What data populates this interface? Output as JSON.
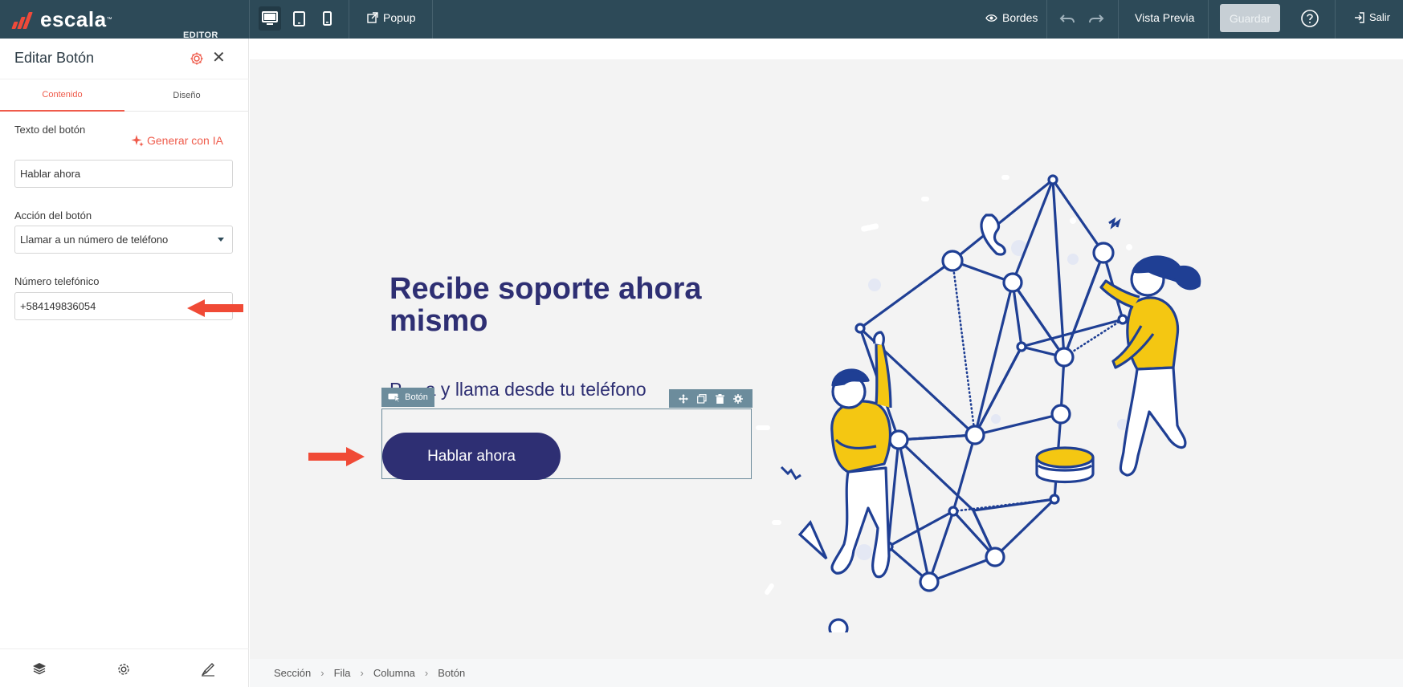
{
  "brand": {
    "name": "escala",
    "tm": "™",
    "editor_label": "EDITOR",
    "bars_color": "#ef4a3a"
  },
  "toolbar": {
    "popup_label": "Popup",
    "borders_label": "Bordes",
    "preview_label": "Vista Previa",
    "save_label": "Guardar",
    "exit_label": "Salir",
    "icons": [
      "desktop-icon",
      "tablet-icon",
      "mobile-icon",
      "external-link-icon",
      "eye-icon",
      "undo-icon",
      "redo-icon",
      "help-icon",
      "logout-icon"
    ]
  },
  "panel": {
    "title": "Editar Botón",
    "tabs": [
      {
        "label": "Contenido",
        "active": true
      },
      {
        "label": "Diseño",
        "active": false
      }
    ],
    "button_text_label": "Texto del botón",
    "ai_label": "Generar con IA",
    "button_text_value": "Hablar ahora",
    "action_label": "Acción del botón",
    "action_value": "Llamar a un número de teléfono",
    "phone_label": "Número telefónico",
    "phone_value": "+584149836054",
    "footer_icons": [
      "layers-icon",
      "settings-icon",
      "brush-icon"
    ]
  },
  "canvas": {
    "title": "Recibe soporte ahora mismo",
    "subtitle_visible": "P",
    "subtitle_rest": "a y llama desde tu teléfono",
    "selection_tag": "Botón",
    "cta_label": "Hablar ahora"
  },
  "breadcrumb": [
    "Sección",
    "Fila",
    "Columna",
    "Botón"
  ],
  "colors": {
    "topbar": "#2d4a58",
    "accent": "#ef5b4b",
    "navy": "#2e2f73",
    "illustration_blue": "#1f3f94",
    "illustration_yellow": "#f4c712"
  }
}
